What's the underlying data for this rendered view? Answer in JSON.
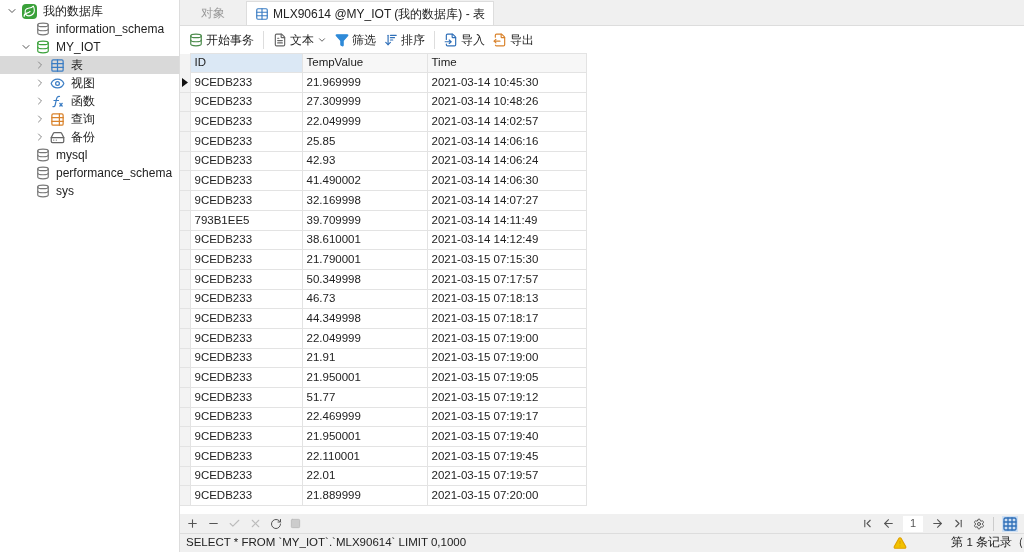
{
  "sidebar": {
    "tree": [
      {
        "label": "我的数据库",
        "kind": "connection",
        "expanded": true,
        "selected": false,
        "children": [
          {
            "label": "information_schema",
            "kind": "database",
            "active": false,
            "selected": false
          },
          {
            "label": "MY_IOT",
            "kind": "database",
            "active": true,
            "expanded": true,
            "selected": false,
            "children": [
              {
                "label": "表",
                "kind": "tables",
                "expanded": false,
                "selected": true
              },
              {
                "label": "视图",
                "kind": "views",
                "expanded": false,
                "selected": false
              },
              {
                "label": "函数",
                "kind": "functions",
                "expanded": false,
                "selected": false
              },
              {
                "label": "查询",
                "kind": "queries",
                "expanded": false,
                "selected": false
              },
              {
                "label": "备份",
                "kind": "backups",
                "expanded": false,
                "selected": false
              }
            ]
          },
          {
            "label": "mysql",
            "kind": "database",
            "active": false,
            "selected": false
          },
          {
            "label": "performance_schema",
            "kind": "database",
            "active": false,
            "selected": false
          },
          {
            "label": "sys",
            "kind": "database",
            "active": false,
            "selected": false
          }
        ]
      }
    ]
  },
  "tabs": [
    {
      "label": "对象",
      "selected": false
    },
    {
      "label": "MLX90614 @MY_IOT (我的数据库) - 表",
      "selected": true
    }
  ],
  "toolbar": [
    {
      "label": "开始事务",
      "kind": "transaction"
    },
    {
      "label": "文本",
      "kind": "text"
    },
    {
      "label": "筛选",
      "kind": "filter"
    },
    {
      "label": "排序",
      "kind": "sort"
    },
    {
      "label": "导入",
      "kind": "import"
    },
    {
      "label": "导出",
      "kind": "export"
    }
  ],
  "table": {
    "columns": [
      "ID",
      "TempValue",
      "Time"
    ],
    "rows": [
      {
        "cells": [
          "9CEDB233",
          "21.969999",
          "2021-03-14 10:45:30"
        ],
        "current": true
      },
      {
        "cells": [
          "9CEDB233",
          "27.309999",
          "2021-03-14 10:48:26"
        ],
        "current": false
      },
      {
        "cells": [
          "9CEDB233",
          "22.049999",
          "2021-03-14 14:02:57"
        ],
        "current": false
      },
      {
        "cells": [
          "9CEDB233",
          "25.85",
          "2021-03-14 14:06:16"
        ],
        "current": false
      },
      {
        "cells": [
          "9CEDB233",
          "42.93",
          "2021-03-14 14:06:24"
        ],
        "current": false
      },
      {
        "cells": [
          "9CEDB233",
          "41.490002",
          "2021-03-14 14:06:30"
        ],
        "current": false
      },
      {
        "cells": [
          "9CEDB233",
          "32.169998",
          "2021-03-14 14:07:27"
        ],
        "current": false
      },
      {
        "cells": [
          "793B1EE5",
          "39.709999",
          "2021-03-14 14:11:49"
        ],
        "current": false
      },
      {
        "cells": [
          "9CEDB233",
          "38.610001",
          "2021-03-14 14:12:49"
        ],
        "current": false
      },
      {
        "cells": [
          "9CEDB233",
          "21.790001",
          "2021-03-15 07:15:30"
        ],
        "current": false
      },
      {
        "cells": [
          "9CEDB233",
          "50.349998",
          "2021-03-15 07:17:57"
        ],
        "current": false
      },
      {
        "cells": [
          "9CEDB233",
          "46.73",
          "2021-03-15 07:18:13"
        ],
        "current": false
      },
      {
        "cells": [
          "9CEDB233",
          "44.349998",
          "2021-03-15 07:18:17"
        ],
        "current": false
      },
      {
        "cells": [
          "9CEDB233",
          "22.049999",
          "2021-03-15 07:19:00"
        ],
        "current": false
      },
      {
        "cells": [
          "9CEDB233",
          "21.91",
          "2021-03-15 07:19:00"
        ],
        "current": false
      },
      {
        "cells": [
          "9CEDB233",
          "21.950001",
          "2021-03-15 07:19:05"
        ],
        "current": false
      },
      {
        "cells": [
          "9CEDB233",
          "51.77",
          "2021-03-15 07:19:12"
        ],
        "current": false
      },
      {
        "cells": [
          "9CEDB233",
          "22.469999",
          "2021-03-15 07:19:17"
        ],
        "current": false
      },
      {
        "cells": [
          "9CEDB233",
          "21.950001",
          "2021-03-15 07:19:40"
        ],
        "current": false
      },
      {
        "cells": [
          "9CEDB233",
          "22.110001",
          "2021-03-15 07:19:45"
        ],
        "current": false
      },
      {
        "cells": [
          "9CEDB233",
          "22.01",
          "2021-03-15 07:19:57"
        ],
        "current": false
      },
      {
        "cells": [
          "9CEDB233",
          "21.889999",
          "2021-03-15 07:20:00"
        ],
        "current": false
      }
    ]
  },
  "page_field": {
    "value": "1"
  },
  "status_bar": {
    "sql": "SELECT * FROM `MY_IOT`.`MLX90614` LIMIT 0,1000",
    "records": "第 1 条记录（"
  }
}
